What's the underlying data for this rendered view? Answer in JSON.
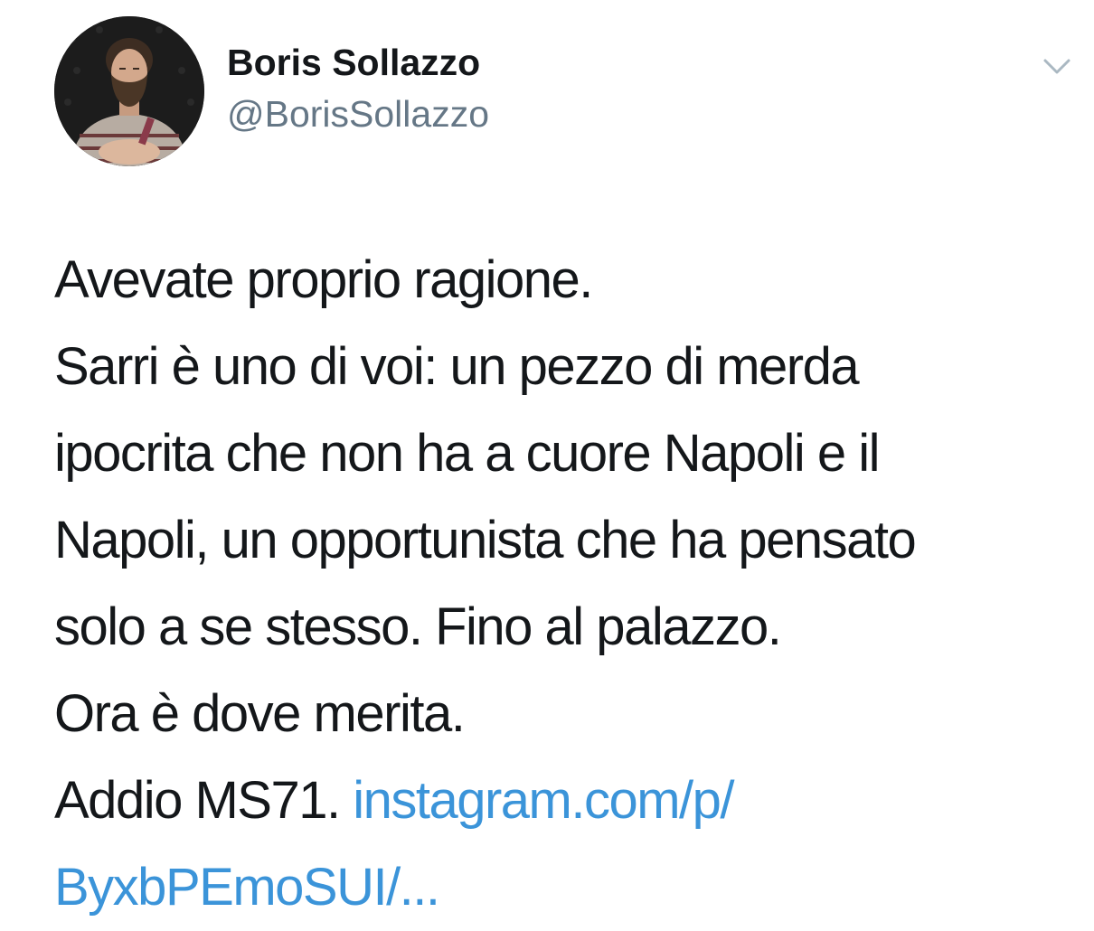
{
  "author": {
    "display_name": "Boris Sollazzo",
    "handle": "@BorisSollazzo"
  },
  "menu": {
    "icon": "chevron-down-icon"
  },
  "tweet": {
    "lines": [
      "Avevate proprio ragione.",
      "Sarri è uno di voi: un pezzo di merda",
      "ipocrita che non ha a cuore Napoli e il",
      "Napoli, un opportunista che ha pensato",
      "solo a se stesso. Fino al palazzo.",
      "Ora è dove merita."
    ],
    "last_line_prefix": "Addio MS71.",
    "link_part1": "instagram.com/p/",
    "link_part2": "ByxbPEmoSUI/..."
  },
  "colors": {
    "text": "#14171a",
    "secondary": "#657786",
    "link": "#3b94d9",
    "chevron": "#aab8c2"
  }
}
